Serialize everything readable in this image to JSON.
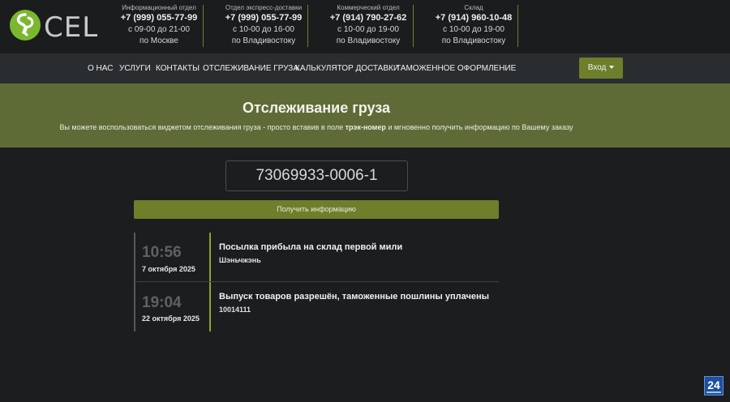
{
  "header": {
    "logo_text": "CEL",
    "contacts": [
      {
        "title": "Информационный отдел",
        "phone": "+7 (999) 055-77-99",
        "hours": "с 09-00 до 21-00",
        "city": "по Москве"
      },
      {
        "title": "Отдел экспресс-доставки",
        "phone": "+7 (999) 055-77-99",
        "hours": "с 10-00 до 16-00",
        "city": "по Владивостоку"
      },
      {
        "title": "Коммерческий отдел",
        "phone": "+7 (914) 790-27-62",
        "hours": "с 10-00 до 19-00",
        "city": "по Владивостоку"
      },
      {
        "title": "Склад",
        "phone": "+7 (914) 960-10-48",
        "hours": "с 10-00 до 19-00",
        "city": "по Владивостоку"
      }
    ]
  },
  "nav": {
    "items": [
      "О НАС",
      "УСЛУГИ",
      "КОНТАКТЫ",
      "ОТСЛЕЖИВАНИЕ ГРУЗА",
      "КАЛЬКУЛЯТОР ДОСТАВКИ",
      "ТАМОЖЕННОЕ ОФОРМЛЕНИЕ"
    ],
    "login_label": "Вход"
  },
  "hero": {
    "title": "Отслеживание груза",
    "text_before": "Вы можете воспользоваться виджетом отслеживания груза - просто вставив в поле ",
    "text_bold": "трэк-номер",
    "text_after": " и мгновенно получить информацию по Вашему заказу"
  },
  "tracking": {
    "input_value": "73069933-0006-1",
    "submit_label": "Получить информацию"
  },
  "timeline": [
    {
      "time": "10:56",
      "date": "7 октября 2025",
      "title": "Посылка прибыла на склад первой мили",
      "sub": "Шэньчжэнь"
    },
    {
      "time": "19:04",
      "date": "22 октября 2025",
      "title": "Выпуск товаров разрешён, таможенные пошлины уплачены",
      "sub": "10014111"
    }
  ],
  "badge": {
    "label": "24"
  },
  "colors": {
    "accent": "#6d7f2b",
    "hero": "#5f6b36",
    "timeline_line": "#8ca334",
    "background": "#1c1d1f"
  }
}
